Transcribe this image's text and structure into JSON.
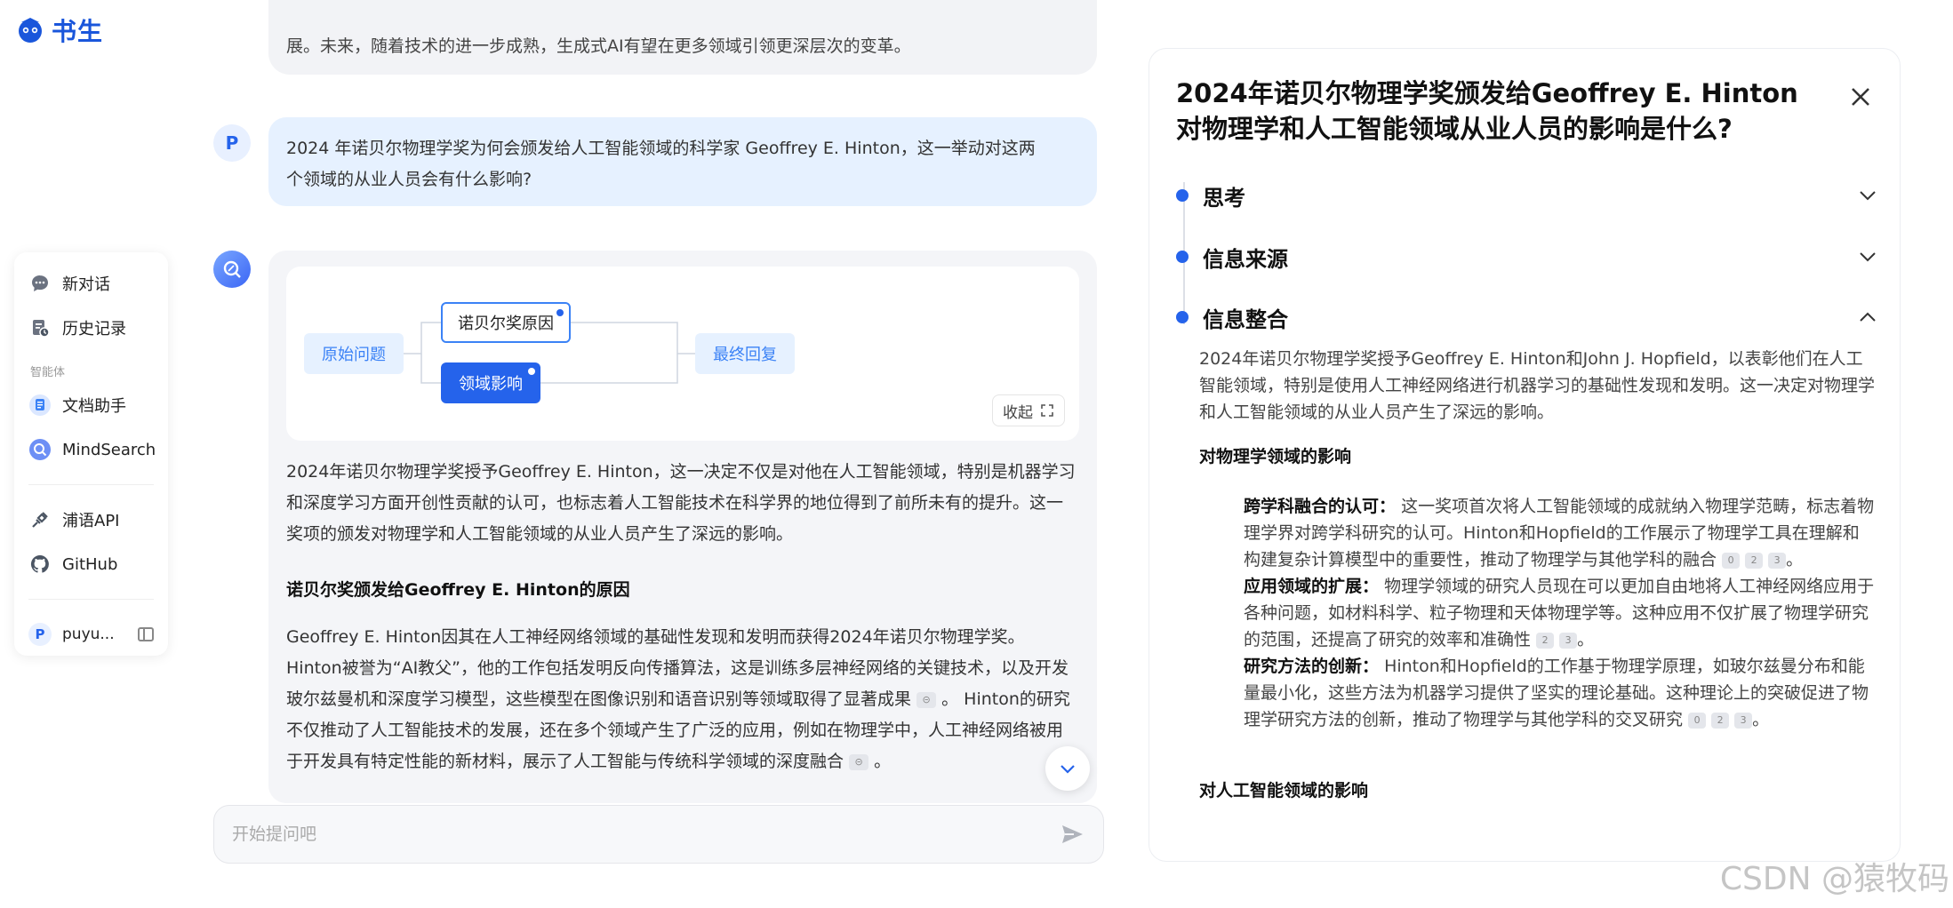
{
  "brand": {
    "name": "书生"
  },
  "sidebar": {
    "items_top": [
      {
        "label": "新对话",
        "icon": "chat-bubble-icon"
      },
      {
        "label": "历史记录",
        "icon": "history-icon"
      }
    ],
    "section_label": "智能体",
    "agents": [
      {
        "label": "文档助手",
        "icon": "document-assistant-icon"
      },
      {
        "label": "MindSearch",
        "icon": "mindsearch-icon"
      }
    ],
    "links": [
      {
        "label": "浦语API",
        "icon": "api-icon"
      },
      {
        "label": "GitHub",
        "icon": "github-icon"
      }
    ],
    "user": {
      "avatar_letter": "P",
      "name": "puyu..."
    }
  },
  "chat": {
    "prev_message_tail": "展。未来，随着技术的进一步成熟，生成式AI有望在更多领域引领更深层次的变革。",
    "user_avatar_letter": "P",
    "user_question_line1": "2024 年诺贝尔物理学奖为何会颁发给人工智能领域的科学家 Geoffrey E. Hinton，这一举动对这两",
    "user_question_line2": "个领域的从业人员会有什么影响?",
    "mindmap": {
      "start": "原始问题",
      "node_a": "诺贝尔奖原因",
      "node_b": "领域影响",
      "end": "最终回复",
      "collapse_label": "收起"
    },
    "answer": {
      "para1": "2024年诺贝尔物理学奖授予Geoffrey E. Hinton，这一决定不仅是对他在人工智能领域，特别是机器学习和深度学习方面开创性贡献的认可，也标志着人工智能技术在科学界的地位得到了前所未有的提升。这一奖项的颁发对物理学和人工智能领域的从业人员产生了深远的影响。",
      "heading1": "诺贝尔奖颁发给Geoffrey E. Hinton的原因",
      "para2": "Geoffrey E. Hinton因其在人工神经网络领域的基础性发现和发明而获得2024年诺贝尔物理学奖。Hinton被誉为“AI教父”，他的工作包括发明反向传播算法，这是训练多层神经网络的关键技术，以及开发玻尔兹曼机和深度学习模型，这些模型在图像识别和语音识别等领域取得了显著成果",
      "para2_end": "。",
      "para3": "Hinton的研究不仅推动了人工智能技术的发展，还在多个领域产生了广泛的应用，例如在物理学中，人工神经网络被用于开发具有特定性能的新材料，展示了人工智能与传统科学领域的深度融合",
      "para3_end": "。"
    },
    "input_placeholder": "开始提问吧"
  },
  "panel": {
    "title": "2024年诺贝尔物理学奖颁发给Geoffrey E. Hinton对物理学和人工智能领域从业人员的影响是什么?",
    "steps": [
      {
        "label": "思考",
        "expanded": false
      },
      {
        "label": "信息来源",
        "expanded": false
      },
      {
        "label": "信息整合",
        "expanded": true
      }
    ],
    "intro": "2024年诺贝尔物理学奖授予Geoffrey E. Hinton和John J. Hopfield，以表彰他们在人工智能领域，特别是使用人工神经网络进行机器学习的基础性发现和发明。这一决定对物理学和人工智能领域的从业人员产生了深远的影响。",
    "section1_title": "对物理学领域的影响",
    "section1_items": [
      {
        "term": "跨学科融合的认可",
        "text": "这一奖项首次将人工智能领域的成就纳入物理学范畴，标志着物理学界对跨学科研究的认可。Hinton和Hopfield的工作展示了物理学工具在理解和构建复杂计算模型中的重要性，推动了物理学与其他学科的融合",
        "cites": [
          "0",
          "2",
          "3"
        ]
      },
      {
        "term": "应用领域的扩展",
        "text": "物理学领域的研究人员现在可以更加自由地将人工神经网络应用于各种问题，如材料科学、粒子物理和天体物理学等。这种应用不仅扩展了物理学研究的范围，还提高了研究的效率和准确性",
        "cites": [
          "2",
          "3"
        ]
      },
      {
        "term": "研究方法的创新",
        "text": "Hinton和Hopfield的工作基于物理学原理，如玻尔兹曼分布和能量最小化，这些方法为机器学习提供了坚实的理论基础。这种理论上的突破促进了物理学研究方法的创新，推动了物理学与其他学科的交叉研究",
        "cites": [
          "0",
          "2",
          "3"
        ]
      }
    ],
    "section2_title": "对人工智能领域的影响"
  },
  "watermark": "CSDN @猿牧码",
  "colors": {
    "accent": "#2563eb",
    "user_bubble": "#e6f1ff",
    "bot_bubble": "#f4f5f8"
  }
}
